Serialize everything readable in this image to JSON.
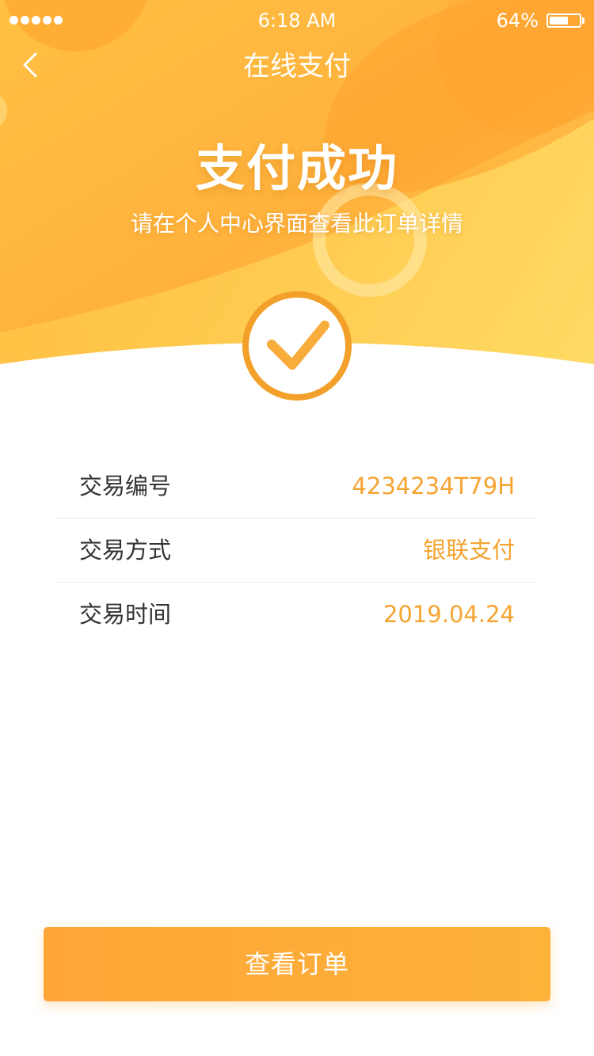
{
  "status_bar": {
    "time": "6:18 AM",
    "battery_percent": "64%",
    "battery_level": 0.64,
    "signal_dots": 5
  },
  "nav": {
    "title": "在线支付",
    "back_icon": "chevron-left-icon"
  },
  "hero": {
    "title": "支付成功",
    "subtitle": "请在个人中心界面查看此订单详情",
    "badge_icon": "checkmark-icon"
  },
  "details": [
    {
      "label": "交易编号",
      "value": "4234234T79H"
    },
    {
      "label": "交易方式",
      "value": "银联支付"
    },
    {
      "label": "交易时间",
      "value": "2019.04.24"
    }
  ],
  "action": {
    "label": "查看订单"
  },
  "colors": {
    "primary": "#f5a431",
    "hero_light": "#ffd35a",
    "hero_dark": "#ffa32f",
    "text_dark": "#333333"
  }
}
